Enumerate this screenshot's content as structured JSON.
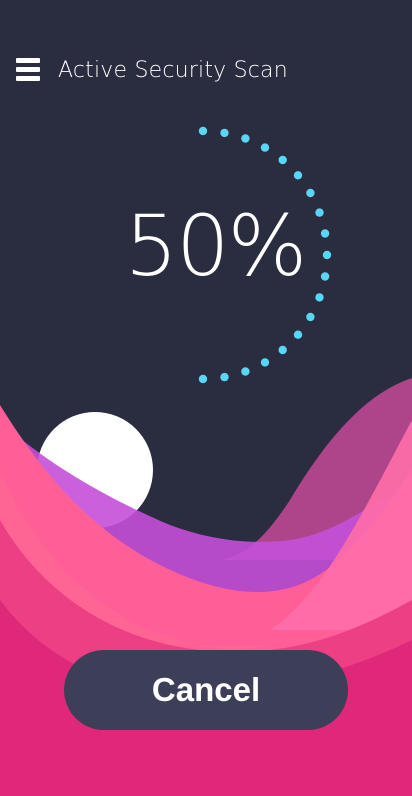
{
  "header": {
    "menu_icon": "hamburger-menu-icon",
    "title": "Active Security Scan"
  },
  "scan": {
    "progress_text": "50%",
    "progress_fraction": 0.5
  },
  "footer": {
    "cancel_label": "Cancel"
  },
  "colors": {
    "background": "#2a2c3f",
    "dots": "#5ad6f5",
    "button": "#3c3f57",
    "wave_pink": "#ff5b95",
    "wave_magenta": "#e0287a",
    "wave_purple": "#c44fd8"
  }
}
